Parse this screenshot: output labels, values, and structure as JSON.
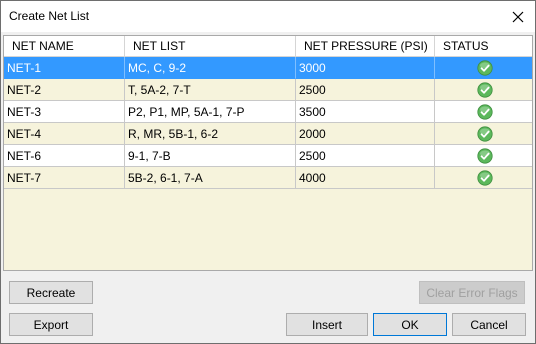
{
  "window": {
    "title": "Create Net List",
    "close_glyph": "✕"
  },
  "table": {
    "columns": [
      "NET NAME",
      "NET LIST",
      "NET PRESSURE (PSI)",
      "STATUS"
    ],
    "rows": [
      {
        "name": "NET-1",
        "list": "MC, C, 9-2",
        "pressure": "3000",
        "status": "ok"
      },
      {
        "name": "NET-2",
        "list": "T, 5A-2, 7-T",
        "pressure": "2500",
        "status": "ok"
      },
      {
        "name": "NET-3",
        "list": "P2, P1, MP, 5A-1, 7-P",
        "pressure": "3500",
        "status": "ok"
      },
      {
        "name": "NET-4",
        "list": "R, MR, 5B-1, 6-2",
        "pressure": "2000",
        "status": "ok"
      },
      {
        "name": "NET-6",
        "list": "9-1, 7-B",
        "pressure": "2500",
        "status": "ok"
      },
      {
        "name": "NET-7",
        "list": "5B-2, 6-1, 7-A",
        "pressure": "4000",
        "status": "ok"
      }
    ],
    "selected_row": 0,
    "status_icon": "check-circle-icon",
    "status_color": "#5cb85c"
  },
  "buttons": {
    "recreate": "Recreate",
    "clear_error_flags": "Clear Error Flags",
    "export": "Export",
    "insert": "Insert",
    "ok": "OK",
    "cancel": "Cancel"
  },
  "colors": {
    "selection": "#3399ff",
    "row_alt": "#f6f3dc",
    "row_plain": "#ffffff"
  }
}
